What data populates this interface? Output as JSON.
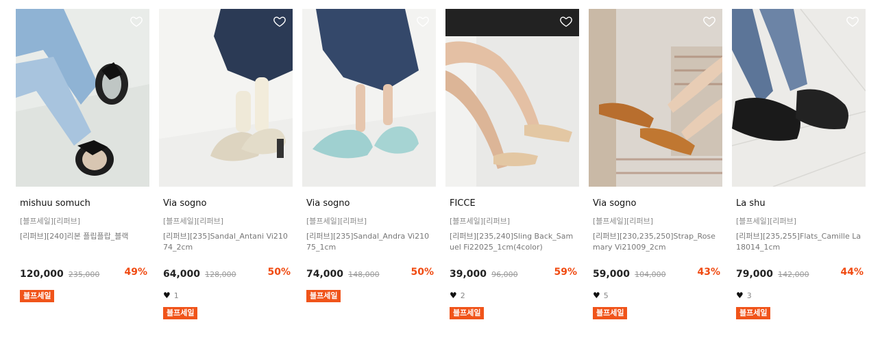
{
  "products": [
    {
      "brand": "mishuu somuch",
      "tag": "[블프세일][리퍼브]",
      "name": "[리퍼브][240]리본 플립플랍_블랙",
      "price": "120,000",
      "original_price": "235,000",
      "discount": "49%",
      "likes": "",
      "badge": "블프세일"
    },
    {
      "brand": "Via sogno",
      "tag": "[블프세일][리퍼브]",
      "name": "[리퍼브][235]Sandal_Antani Vi21074_2cm",
      "price": "64,000",
      "original_price": "128,000",
      "discount": "50%",
      "likes": "1",
      "badge": "블프세일"
    },
    {
      "brand": "Via sogno",
      "tag": "[블프세일][리퍼브]",
      "name": "[리퍼브][235]Sandal_Andra Vi21075_1cm",
      "price": "74,000",
      "original_price": "148,000",
      "discount": "50%",
      "likes": "",
      "badge": "블프세일"
    },
    {
      "brand": "FICCE",
      "tag": "[블프세일][리퍼브]",
      "name": "[리퍼브][235,240]Sling Back_Samuel Fi22025_1cm(4color)",
      "price": "39,000",
      "original_price": "96,000",
      "discount": "59%",
      "likes": "2",
      "badge": "블프세일"
    },
    {
      "brand": "Via sogno",
      "tag": "[블프세일][리퍼브]",
      "name": "[리퍼브][230,235,250]Strap_Rosemary Vi21009_2cm",
      "price": "59,000",
      "original_price": "104,000",
      "discount": "43%",
      "likes": "5",
      "badge": "블프세일"
    },
    {
      "brand": "La shu",
      "tag": "[블프세일][리퍼브]",
      "name": "[리퍼브][235,255]Flats_Camille La18014_1cm",
      "price": "79,000",
      "original_price": "142,000",
      "discount": "44%",
      "likes": "3",
      "badge": "블프세일"
    }
  ],
  "colors": {
    "discount": "#f04b12",
    "badge": "#f0541a"
  }
}
